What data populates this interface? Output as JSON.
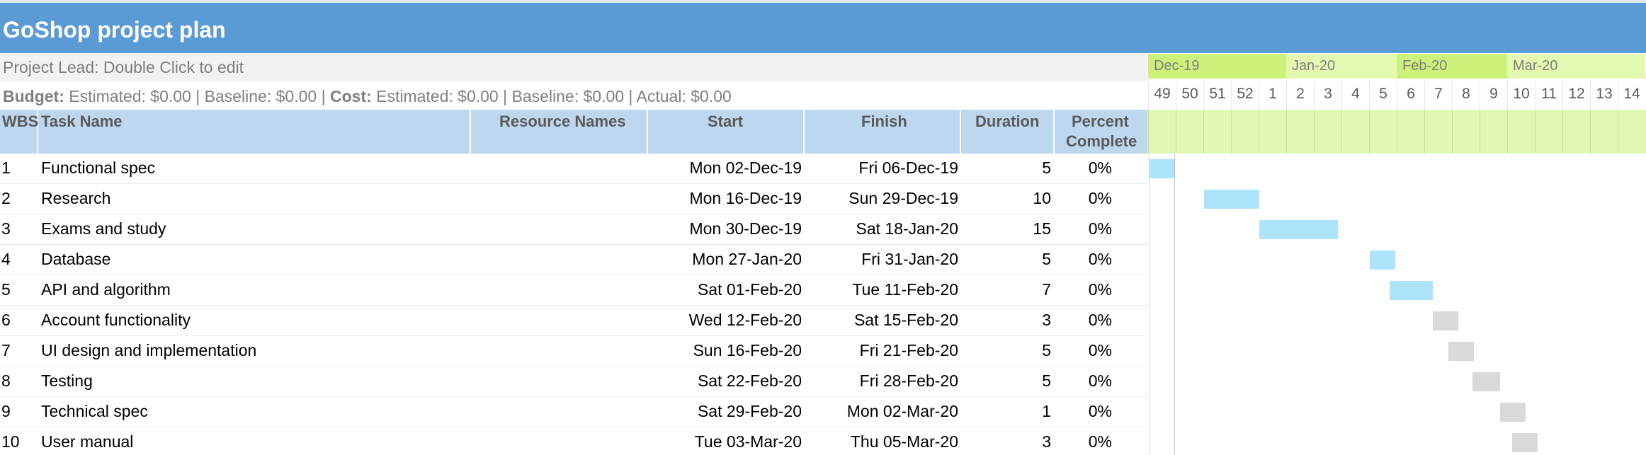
{
  "title": "GoShop project plan",
  "project_lead": "Project Lead: Double Click to edit",
  "budget": {
    "budget_label": "Budget:",
    "budget_values": " Estimated: $0.00 | Baseline: $0.00 | ",
    "cost_label": "Cost:",
    "cost_values": " Estimated: $0.00 | Baseline: $0.00 | Actual: $0.00"
  },
  "columns": {
    "wbs": "WBS",
    "task_name": "Task Name",
    "resource_names": "Resource Names",
    "start": "Start",
    "finish": "Finish",
    "duration": "Duration",
    "percent_line1": "Percent",
    "percent_line2": "Complete"
  },
  "tasks": [
    {
      "wbs": "1",
      "name": "Functional spec",
      "resources": "",
      "start": "Mon 02-Dec-19",
      "finish": "Fri 06-Dec-19",
      "duration": "5",
      "percent": "0%"
    },
    {
      "wbs": "2",
      "name": "Research",
      "resources": "",
      "start": "Mon 16-Dec-19",
      "finish": "Sun 29-Dec-19",
      "duration": "10",
      "percent": "0%"
    },
    {
      "wbs": "3",
      "name": "Exams and study",
      "resources": "",
      "start": "Mon 30-Dec-19",
      "finish": "Sat 18-Jan-20",
      "duration": "15",
      "percent": "0%"
    },
    {
      "wbs": "4",
      "name": "Database",
      "resources": "",
      "start": "Mon 27-Jan-20",
      "finish": "Fri 31-Jan-20",
      "duration": "5",
      "percent": "0%"
    },
    {
      "wbs": "5",
      "name": "API and algorithm",
      "resources": "",
      "start": "Sat 01-Feb-20",
      "finish": "Tue 11-Feb-20",
      "duration": "7",
      "percent": "0%"
    },
    {
      "wbs": "6",
      "name": "Account functionality",
      "resources": "",
      "start": "Wed 12-Feb-20",
      "finish": "Sat 15-Feb-20",
      "duration": "3",
      "percent": "0%"
    },
    {
      "wbs": "7",
      "name": "UI design and implementation",
      "resources": "",
      "start": "Sun 16-Feb-20",
      "finish": "Fri 21-Feb-20",
      "duration": "5",
      "percent": "0%"
    },
    {
      "wbs": "8",
      "name": "Testing",
      "resources": "",
      "start": "Sat 22-Feb-20",
      "finish": "Fri 28-Feb-20",
      "duration": "5",
      "percent": "0%"
    },
    {
      "wbs": "9",
      "name": "Technical spec",
      "resources": "",
      "start": "Sat 29-Feb-20",
      "finish": "Mon 02-Mar-20",
      "duration": "1",
      "percent": "0%"
    },
    {
      "wbs": "10",
      "name": "User manual",
      "resources": "",
      "start": "Tue 03-Mar-20",
      "finish": "Thu 05-Mar-20",
      "duration": "3",
      "percent": "0%"
    }
  ],
  "timeline": {
    "months": [
      {
        "label": "Dec-19",
        "color": "#ccf07a"
      },
      {
        "label": "Jan-20",
        "color": "#e4f8b0"
      },
      {
        "label": "Feb-20",
        "color": "#ccf07a"
      },
      {
        "label": "Mar-20",
        "color": "#e4f8b0"
      }
    ],
    "weeks": [
      "49",
      "50",
      "51",
      "52",
      "1",
      "2",
      "3",
      "4",
      "5",
      "6",
      "7",
      "8",
      "9",
      "10",
      "11",
      "12",
      "13",
      "14"
    ],
    "bar_colors": {
      "early": "#aee4fb",
      "late": "#d9d9d9"
    }
  }
}
